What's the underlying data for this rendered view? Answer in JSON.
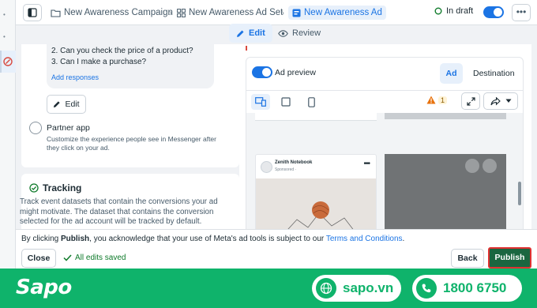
{
  "breadcrumb": {
    "campaign": "New Awareness Campaign",
    "adset": "New Awareness Ad Set",
    "ad": "New Awareness Ad"
  },
  "status": {
    "label": "In draft",
    "published_toggle_on": true
  },
  "tabs": {
    "edit": "Edit",
    "review": "Review"
  },
  "messenger": {
    "questions": [
      "2. Can you check the price of a product?",
      "3. Can I make a purchase?"
    ],
    "add_responses": "Add responses",
    "edit_label": "Edit"
  },
  "partner_app": {
    "title": "Partner app",
    "description": "Customize the experience people see in Messenger after they click on your ad."
  },
  "tracking": {
    "title": "Tracking",
    "description": "Track event datasets that contain the conversions your ad might motivate. The dataset that contains the conversion selected for the ad account will be tracked by default."
  },
  "preview": {
    "label": "Ad preview",
    "toggle_on": true,
    "segments": {
      "ad": "Ad",
      "destination": "Destination"
    },
    "warning_count": "1",
    "ad_card": {
      "page_name": "Zenith Notebook",
      "sponsored": "Sponsored ·"
    }
  },
  "footer": {
    "ack_prefix": "By clicking ",
    "ack_bold": "Publish",
    "ack_middle": ", you acknowledge that your use of Meta's ad tools is subject to our ",
    "ack_link": "Terms and Conditions",
    "ack_end": ".",
    "close": "Close",
    "saved": "All edits saved",
    "back": "Back",
    "publish": "Publish"
  },
  "banner": {
    "brand": "Sapo",
    "website": "sapo.vn",
    "phone": "1800 6750"
  },
  "colors": {
    "accent": "#1b74e4",
    "publish": "#1a6640",
    "banner": "#0fb36b",
    "warning": "#e8720c"
  }
}
